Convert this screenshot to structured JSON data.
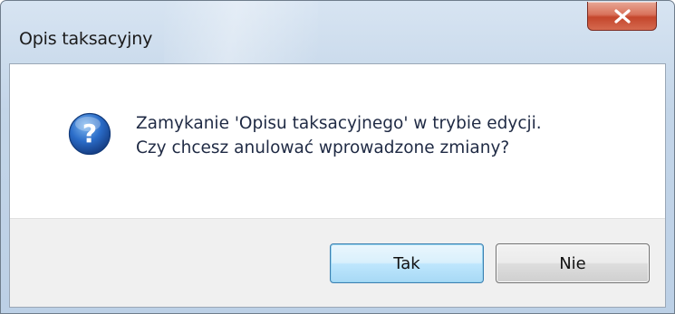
{
  "dialog": {
    "title": "Opis taksacyjny",
    "close_label": "x",
    "message_line1": "Zamykanie 'Opisu taksacyjnego' w trybie edycji.",
    "message_line2": "Czy chcesz anulować wprowadzone zmiany?",
    "icon": "question-icon",
    "buttons": {
      "yes_label": "Tak",
      "no_label": "Nie"
    }
  },
  "colors": {
    "title_bar": "#c3d5e8",
    "close_button": "#c4462c",
    "default_button_border": "#3c7fb1",
    "icon_blue": "#2a6cc8"
  }
}
